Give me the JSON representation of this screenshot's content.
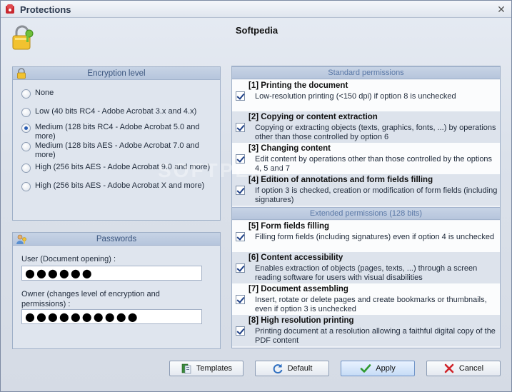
{
  "window": {
    "title": "Protections",
    "close_glyph": "✕"
  },
  "brand": "Softpedia",
  "watermark": "SOFTPEDIA",
  "encryption": {
    "header": "Encryption level",
    "options": [
      {
        "label": "None",
        "checked": false
      },
      {
        "label": "Low (40 bits RC4 - Adobe Acrobat 3.x and 4.x)",
        "checked": false
      },
      {
        "label": "Medium (128 bits RC4 - Adobe Acrobat 5.0 and more)",
        "checked": true
      },
      {
        "label": "Medium (128 bits AES - Adobe Acrobat 7.0 and more)",
        "checked": false
      },
      {
        "label": "High (256 bits AES - Adobe Acrobat 9.0 and more)",
        "checked": false
      },
      {
        "label": "High (256 bits AES - Adobe Acrobat X and more)",
        "checked": false
      }
    ]
  },
  "passwords": {
    "header": "Passwords",
    "user_label": "User (Document opening) :",
    "user_value": "●●●●●●",
    "owner_label": "Owner (changes level of encryption and permissions) :",
    "owner_value": "●●●●●●●●●●"
  },
  "permissions": {
    "standard_header": "Standard permissions",
    "extended_header": "Extended permissions (128 bits)",
    "standard": [
      {
        "title": "[1] Printing the document",
        "desc": "Low-resolution printing (<150 dpi) if option 8 is unchecked",
        "checked": true
      },
      {
        "title": "[2] Copying or content extraction",
        "desc": "Copying or extracting objects (texts, graphics, fonts, ...) by operations other than those controlled by option 6",
        "checked": true
      },
      {
        "title": "[3] Changing content",
        "desc": "Edit content by operations other than those controlled by the options 4, 5 and 7",
        "checked": true
      },
      {
        "title": "[4] Edition of annotations and form fields filling",
        "desc": "If option 3 is checked, creation or modification of form fields (including signatures)",
        "checked": true
      }
    ],
    "extended": [
      {
        "title": "[5] Form fields filling",
        "desc": "Filling form fields (including signatures) even if option 4 is unchecked",
        "checked": true
      },
      {
        "title": "[6] Content accessibility",
        "desc": "Enables extraction of objects (pages, texts, ...) through a screen reading software for users with visual disabilities",
        "checked": true
      },
      {
        "title": "[7] Document assembling",
        "desc": "Insert, rotate or delete pages and create bookmarks or thumbnails, even if option 3 is unchecked",
        "checked": true
      },
      {
        "title": "[8] High resolution printing",
        "desc": "Printing document at a resolution allowing a faithful digital copy of the PDF content",
        "checked": true
      }
    ]
  },
  "buttons": {
    "templates": "Templates",
    "default": "Default",
    "apply": "Apply",
    "cancel": "Cancel"
  },
  "colors": {
    "accent": "#2a5db3",
    "header_text": "#3a557e",
    "cancel_x": "#d0242a",
    "apply_check": "#2f9a2f"
  }
}
